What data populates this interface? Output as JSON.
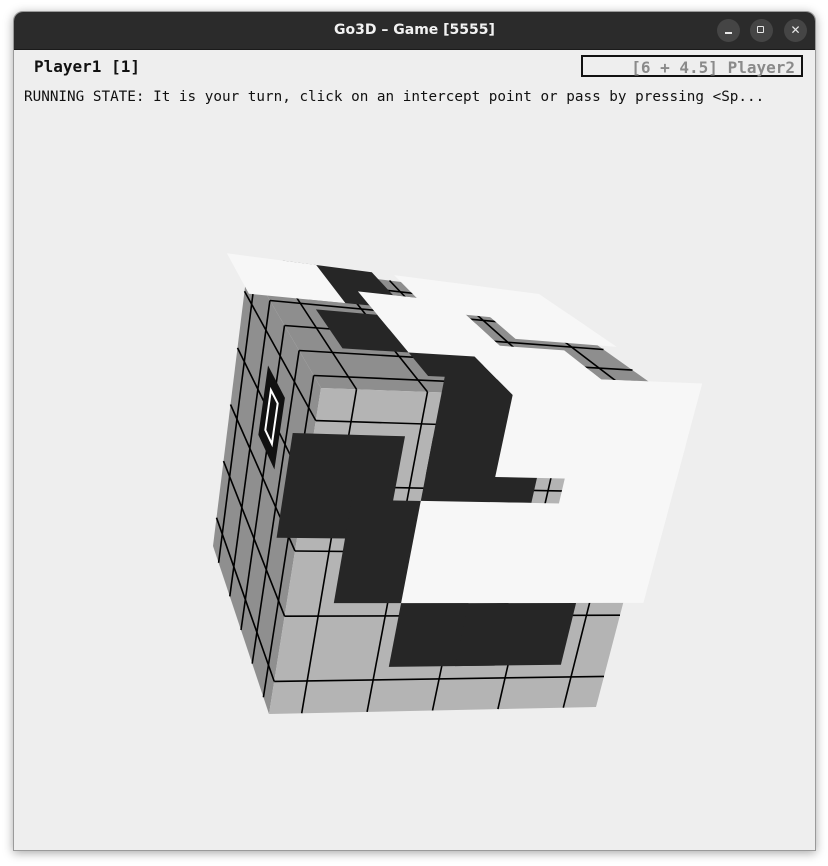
{
  "window": {
    "title": "Go3D – Game [5555]",
    "buttons": {
      "minimize": "minimize-icon",
      "maximize": "maximize-icon",
      "close": "close-icon"
    }
  },
  "score": {
    "player1_label": "Player1 [1]",
    "player2_label": "[6 + 4.5] Player2"
  },
  "status_text": "RUNNING STATE: It is your turn, click on an intercept point or pass by pressing <Sp...",
  "board": {
    "grid_size": 5,
    "stones": {
      "front": {
        "black": [
          [
            2,
            0
          ],
          [
            0,
            1
          ],
          [
            2,
            1
          ],
          [
            1,
            2
          ],
          [
            2,
            3
          ],
          [
            3,
            3
          ]
        ],
        "white": [
          [
            3,
            0
          ],
          [
            4,
            0
          ],
          [
            4,
            1
          ],
          [
            2,
            2
          ],
          [
            3,
            2
          ],
          [
            4,
            2
          ]
        ]
      },
      "top": {
        "black": [
          [
            1,
            0
          ],
          [
            2,
            1
          ],
          [
            1,
            2
          ],
          [
            2,
            3
          ]
        ],
        "white": [
          [
            0,
            0
          ],
          [
            3,
            0
          ],
          [
            4,
            0
          ],
          [
            2,
            1
          ],
          [
            4,
            1
          ],
          [
            2,
            2
          ],
          [
            3,
            3
          ],
          [
            3,
            4
          ]
        ]
      },
      "left": {
        "black": [],
        "white": []
      }
    },
    "cursor_on_left_face": true,
    "colors": {
      "front_face": "#b4b4b4",
      "top_face": "#8e8e8e",
      "left_face": "#8f8f8f",
      "black_stone": "#262626",
      "white_stone": "#f7f7f7",
      "grid_line": "#000000"
    }
  }
}
